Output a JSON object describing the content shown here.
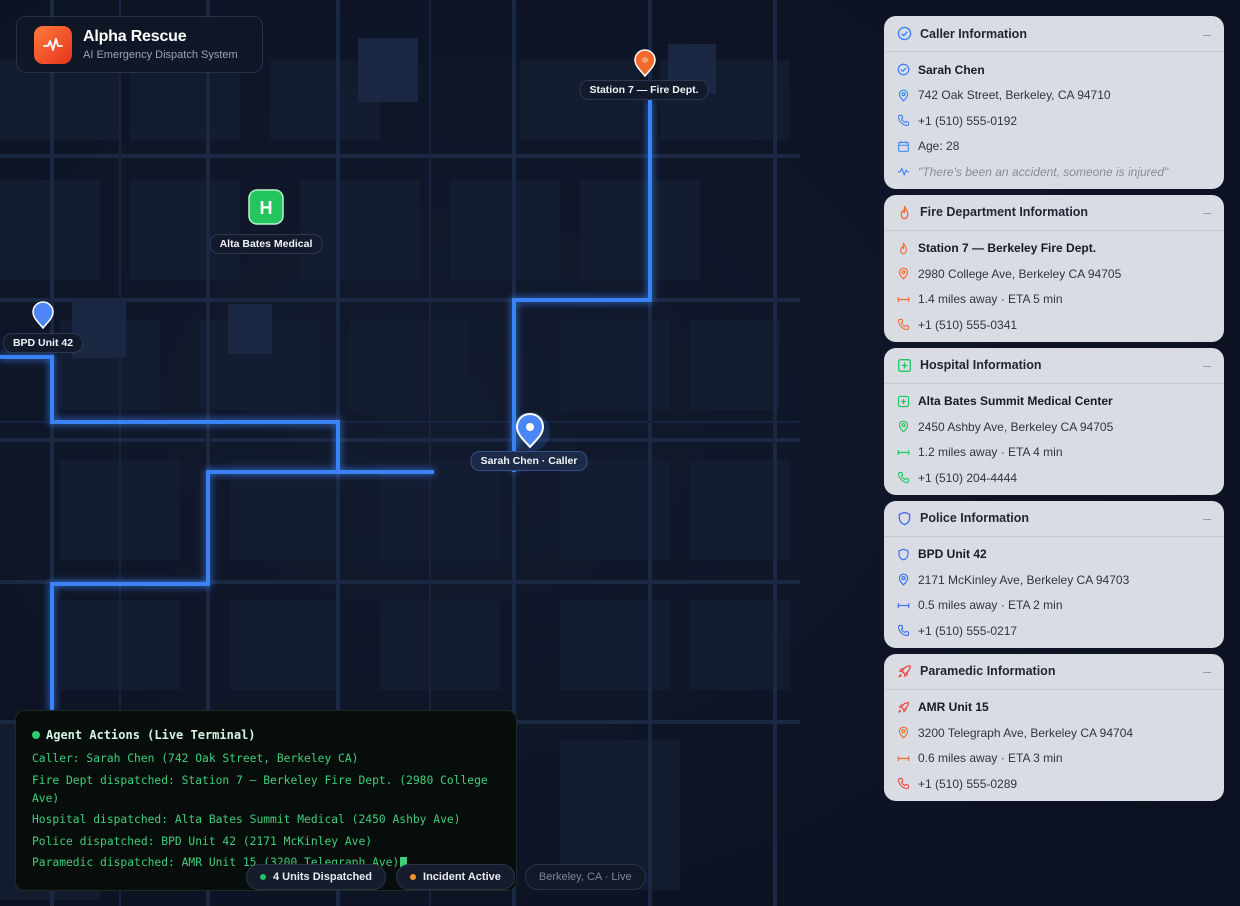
{
  "app": {
    "title": "Alpha Rescue",
    "subtitle": "AI Emergency Dispatch System",
    "logo_icon": "pulse-icon",
    "accent": "#f26b2d"
  },
  "map": {
    "labels": {
      "fire_station": "Station 7 — Fire Dept.",
      "hospital": "Alta Bates Medical",
      "hospital_badge": "H",
      "police": "BPD Unit 42",
      "caller": "Sarah Chen · Caller"
    },
    "colors": {
      "route": "#3b82f6",
      "fire": "#f26b2d",
      "hospital": "#22c55e",
      "police": "#4f86f7"
    }
  },
  "panels": {
    "caller": {
      "title": "Caller Information",
      "icon": "check-circle-icon",
      "collapse": "–",
      "name": "Sarah Chen",
      "address": "742 Oak Street, Berkeley, CA 94710",
      "phone": "+1 (510) 555-0192",
      "age": "Age: 28",
      "quote": "\"There's been an accident, someone is injured\""
    },
    "fire": {
      "title": "Fire Department Information",
      "icon": "flame-icon",
      "collapse": "–",
      "name": "Station 7 — Berkeley Fire Dept.",
      "address": "2980 College Ave, Berkeley CA 94705",
      "distance": "1.4 miles away · ETA 5 min",
      "phone": "+1 (510) 555-0341"
    },
    "hospital": {
      "title": "Hospital Information",
      "icon": "plus-square-icon",
      "collapse": "–",
      "name": "Alta Bates Summit Medical Center",
      "address": "2450 Ashby Ave, Berkeley CA 94705",
      "distance": "1.2 miles away · ETA 4 min",
      "phone": "+1 (510) 204-4444"
    },
    "police": {
      "title": "Police Information",
      "icon": "shield-icon",
      "collapse": "–",
      "name": "BPD Unit 42",
      "address": "2171 McKinley Ave, Berkeley CA 94703",
      "distance": "0.5 miles away · ETA 2 min",
      "phone": "+1 (510) 555-0217"
    },
    "paramedic": {
      "title": "Paramedic Information",
      "icon": "rocket-icon",
      "collapse": "–",
      "name": "AMR Unit 15",
      "address": "3200 Telegraph Ave, Berkeley CA 94704",
      "distance": "0.6 miles away · ETA 3 min",
      "phone": "+1 (510) 555-0289"
    }
  },
  "terminal": {
    "title": "Agent Actions (Live Terminal)",
    "lines": [
      "Caller: Sarah Chen (742 Oak Street, Berkeley CA)",
      "Fire Dept dispatched: Station 7 — Berkeley Fire Dept. (2980 College Ave)",
      "Hospital dispatched: Alta Bates Summit Medical (2450 Ashby Ave)",
      "Police dispatched: BPD Unit 42 (2171 McKinley Ave)",
      "Paramedic dispatched: AMR Unit 15 (3200 Telegraph Ave)"
    ]
  },
  "status": {
    "units": "4 Units Dispatched",
    "incident": "Incident Active",
    "location": "Berkeley, CA · Live",
    "units_color": "#22c55e",
    "incident_color": "#f5922e"
  }
}
